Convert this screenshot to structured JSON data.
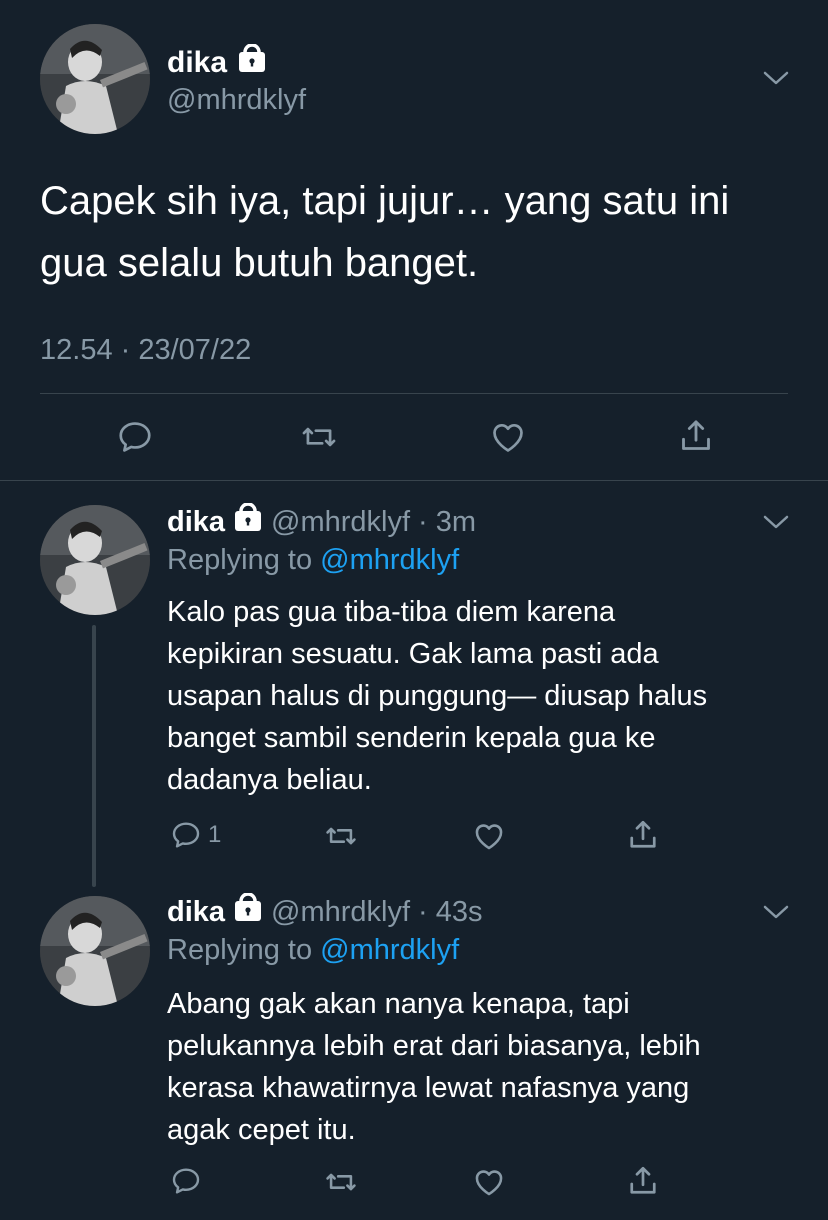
{
  "main_tweet": {
    "name": "dika",
    "handle": "@mhrdklyf",
    "text_line1": "Capek sih iya, tapi jujur… yang satu ini",
    "text_line2": "gua selalu butuh banget.",
    "timestamp": "12.54 · 23/07/22"
  },
  "replies": [
    {
      "name": "dika",
      "handle": "@mhrdklyf",
      "time": "· 3m",
      "replying_prefix": "Replying to",
      "replying_to": "@mhrdklyf",
      "lines": [
        "Kalo pas gua tiba-tiba diem karena",
        "kepikiran sesuatu. Gak lama pasti ada",
        "usapan halus di punggung— diusap halus",
        "banget sambil senderin kepala gua ke",
        "dadanya beliau."
      ],
      "reply_count": "1"
    },
    {
      "name": "dika",
      "handle": "@mhrdklyf",
      "time": "· 43s",
      "replying_prefix": "Replying to",
      "replying_to": "@mhrdklyf",
      "lines": [
        "Abang gak akan nanya kenapa, tapi",
        "pelukannya lebih erat dari biasanya, lebih",
        "kerasa khawatirnya lewat nafasnya yang",
        "agak cepet itu."
      ],
      "reply_count": ""
    }
  ],
  "icons": {
    "lock": "lock-icon",
    "chevron": "chevron-down-icon",
    "reply": "reply-icon",
    "retweet": "retweet-icon",
    "like": "heart-icon",
    "share": "share-icon"
  },
  "colors": {
    "background": "#15202b",
    "secondary_text": "#8899a6",
    "link": "#1da1f2",
    "divider": "#38444d"
  }
}
